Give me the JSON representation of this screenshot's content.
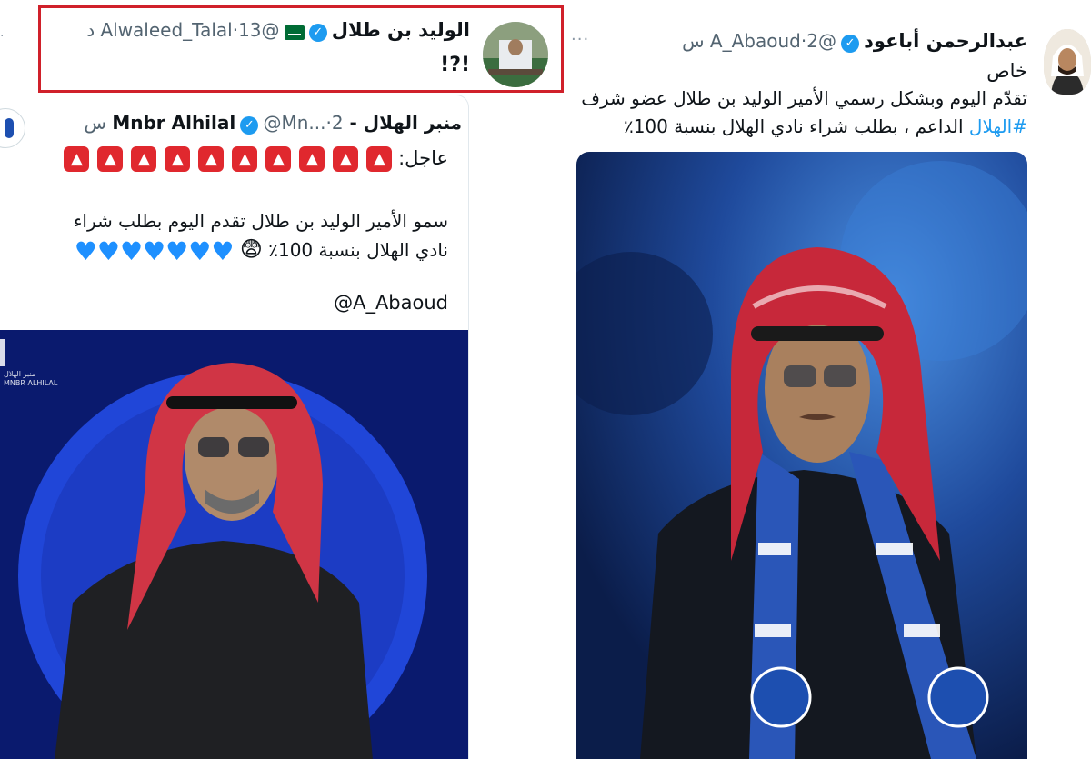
{
  "right_tweet": {
    "author_name": "عبدالرحمن أباعود",
    "handle": "@A_Abaoud",
    "time": "2 س",
    "separator": "·",
    "more": "···",
    "label": "خاص",
    "body_line1": "تقدّم اليوم وبشكل رسمي الأمير الوليد بن طلال عضو شرف",
    "hashtag": "#الهلال",
    "body_line2_rest": " الداعم ، بطلب شراء نادي الهلال بنسبة 100٪",
    "verified_icon": "✓"
  },
  "highlighted_tweet": {
    "author_name": "الوليد بن طلال",
    "flag_icon": "saudi-flag",
    "handle": "@Alwaleed_Talal",
    "time": "13 د",
    "separator": "·",
    "body": "!?!",
    "verified_icon": "✓",
    "highlight_color": "#d0202a"
  },
  "quoted_tweet": {
    "author_name": "منبر الهلال - Mnbr Alhilal",
    "handle": "@Mn...",
    "time": "2 س",
    "separator": "·",
    "alert_label": "عاجل:",
    "siren_count": 10,
    "body_line1": "سمو الأمير الوليد بن طلال تقدم اليوم بطلب شراء",
    "body_line2": "نادي الهلال بنسبة 100٪",
    "emoji_shocked": "😨",
    "heart_count": 7,
    "mention": "@A_Abaoud",
    "verified_icon": "✓",
    "brand_logo_text": "منبر الهلال",
    "brand_logo_latin": "MNBR ALHILAL"
  },
  "colors": {
    "link": "#1d9bf0",
    "photo_right_bg": "#1c3f86",
    "photo_left_bg": "#0a1a6e",
    "highlight": "#d0202a"
  }
}
